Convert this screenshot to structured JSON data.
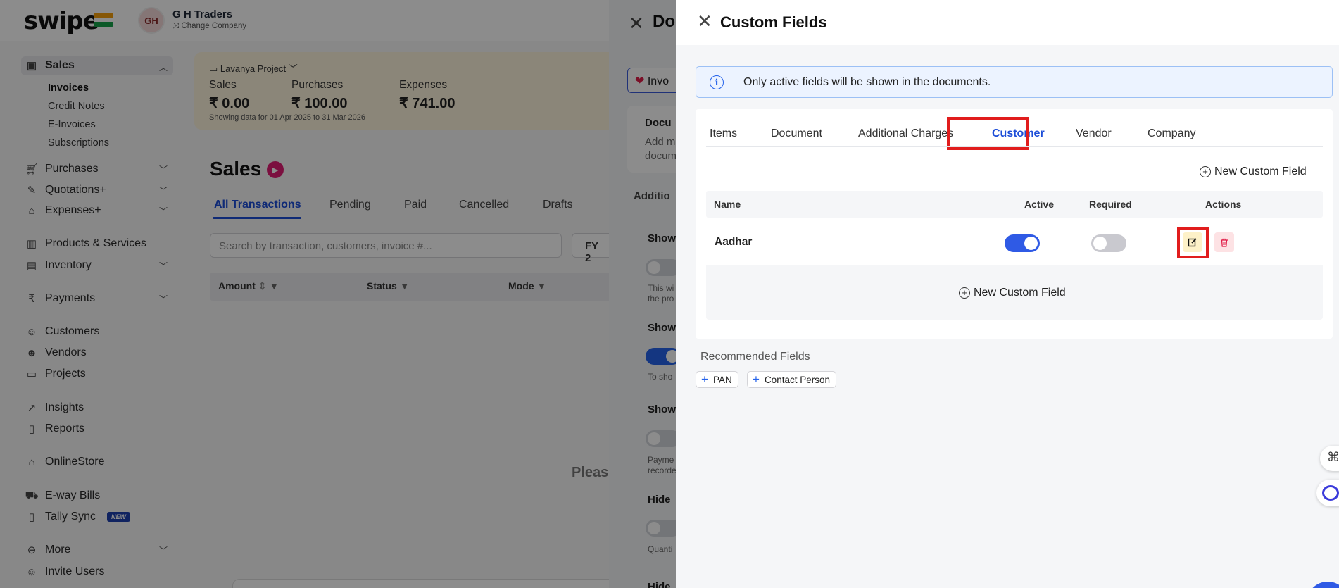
{
  "app": {
    "logo": "swipe",
    "company": {
      "initials": "GH",
      "name": "G H Traders",
      "change_label": "Change Company"
    }
  },
  "sidebar": {
    "sales": "Sales",
    "sales_sub": [
      "Invoices",
      "Credit Notes",
      "E-Invoices",
      "Subscriptions"
    ],
    "purchases": "Purchases",
    "quotations": "Quotations+",
    "expenses": "Expenses+",
    "products": "Products & Services",
    "inventory": "Inventory",
    "payments": "Payments",
    "customers": "Customers",
    "vendors": "Vendors",
    "projects": "Projects",
    "insights": "Insights",
    "reports": "Reports",
    "onlinestore": "OnlineStore",
    "eway": "E-way Bills",
    "tally": "Tally Sync",
    "tally_badge": "NEW",
    "more": "More",
    "invite": "Invite Users"
  },
  "summary": {
    "project": "Lavanya Project",
    "sales_label": "Sales",
    "sales_value": "₹ 0.00",
    "purchases_label": "Purchases",
    "purchases_value": "₹ 100.00",
    "expenses_label": "Expenses",
    "expenses_value": "₹ 741.00",
    "note": "Showing data for 01 Apr 2025 to 31 Mar 2026"
  },
  "sales_page": {
    "title": "Sales",
    "tabs": [
      "All Transactions",
      "Pending",
      "Paid",
      "Cancelled",
      "Drafts"
    ],
    "search_placeholder": "Search by transaction, customers, invoice #...",
    "fy": "FY 2",
    "columns": [
      "Amount",
      "Status",
      "Mode"
    ],
    "empty_text": "Pleas"
  },
  "document_drawer": {
    "title": "Do",
    "pill": "Invo",
    "card_title": "Docu",
    "card_text": [
      "Add m",
      "docum"
    ],
    "additional": "Additio",
    "sections": [
      {
        "label": "Show",
        "note": [
          "This wi",
          "the pro"
        ]
      },
      {
        "label": "Show",
        "note": [
          "To sho"
        ]
      },
      {
        "label": "Show",
        "note": [
          "Payme",
          "recorde"
        ]
      },
      {
        "label": "Hide",
        "note": [
          "Quanti"
        ]
      },
      {
        "label": "Hide"
      }
    ]
  },
  "custom_fields": {
    "title": "Custom Fields",
    "info": "Only active fields will be shown in the documents.",
    "tabs": [
      "Items",
      "Document",
      "Additional Charges",
      "Customer",
      "Vendor",
      "Company"
    ],
    "active_tab": "Customer",
    "new_field_label": "New Custom Field",
    "columns": {
      "name": "Name",
      "active": "Active",
      "required": "Required",
      "actions": "Actions"
    },
    "rows": [
      {
        "name": "Aadhar",
        "active": true,
        "required": false
      }
    ],
    "recommended_title": "Recommended Fields",
    "recommended": [
      "PAN",
      "Contact Person"
    ],
    "colors": {
      "accent": "#1d4ed8",
      "highlight": "#e11d1d",
      "toggle_on": "#2f5ae5"
    }
  }
}
